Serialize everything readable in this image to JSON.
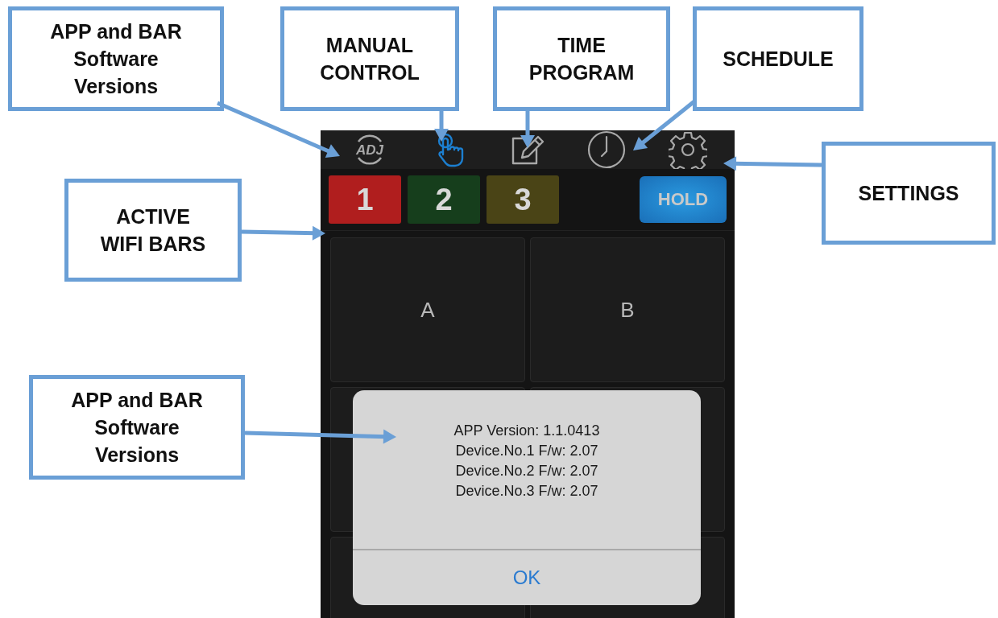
{
  "callouts": [
    {
      "text": "APP and BAR\nSoftware\nVersions"
    },
    {
      "text": "MANUAL\nCONTROL"
    },
    {
      "text": "TIME\nPROGRAM"
    },
    {
      "text": "SCHEDULE"
    },
    {
      "text": "SETTINGS"
    },
    {
      "text": "ACTIVE\nWIFI BARS"
    },
    {
      "text": "APP and BAR\nSoftware\nVersions"
    }
  ],
  "toolbar": [
    {
      "kind": "logo",
      "label": "ADJ",
      "selected": false
    },
    {
      "kind": "touch",
      "selected": true
    },
    {
      "kind": "edit",
      "selected": false
    },
    {
      "kind": "clock",
      "selected": false
    },
    {
      "kind": "settings",
      "selected": false
    }
  ],
  "bars": [
    {
      "label": "1",
      "color": "#b01e1e"
    },
    {
      "label": "2",
      "color": "#163e1c"
    },
    {
      "label": "3",
      "color": "#4a4416"
    }
  ],
  "hold_button": "HOLD",
  "pads": [
    "A",
    "B"
  ],
  "dialog": {
    "lines": [
      "APP Version: 1.1.0413",
      "Device.No.1 F/w: 2.07",
      "Device.No.2 F/w: 2.07",
      "Device.No.3 F/w: 2.07"
    ],
    "button": "OK"
  }
}
